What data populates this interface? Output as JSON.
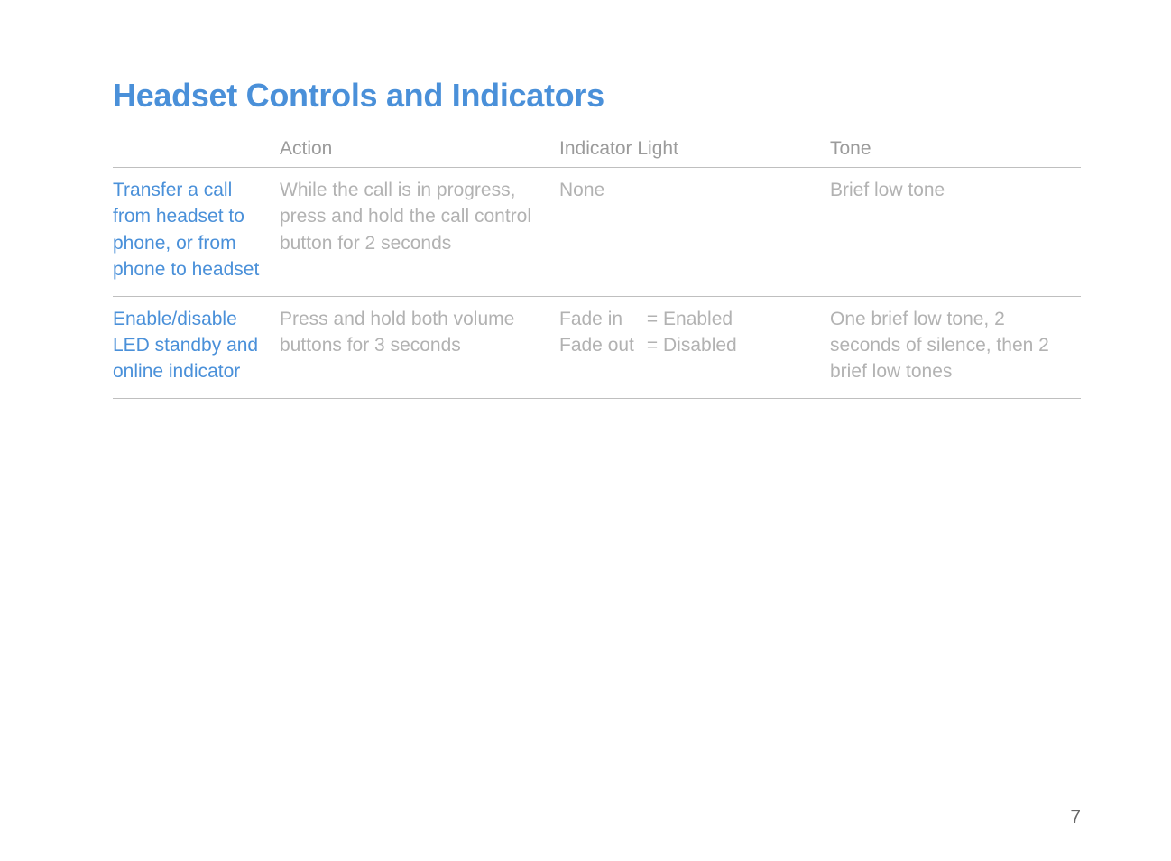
{
  "title": "Headset Controls and Indicators",
  "headers": {
    "col0": "",
    "col1": "Action",
    "col2": "Indicator Light",
    "col3": "Tone"
  },
  "row0": {
    "label": "Transfer a call from headset to phone, or from phone to headset",
    "action": "While the call is in progress, press and hold the call control button for 2 seconds",
    "indicator": "None",
    "tone": "Brief low tone"
  },
  "row1": {
    "label": "Enable/disable LED standby and online indicator",
    "action": "Press and hold both volume buttons for 3 seconds",
    "indicator_fadein_left": "Fade in",
    "indicator_fadein_right": "=  Enabled",
    "indicator_fadeout_left": "Fade out",
    "indicator_fadeout_right": "=  Disabled",
    "tone": "One brief low tone, 2 seconds of silence, then 2 brief low tones"
  },
  "pageNumber": "7"
}
